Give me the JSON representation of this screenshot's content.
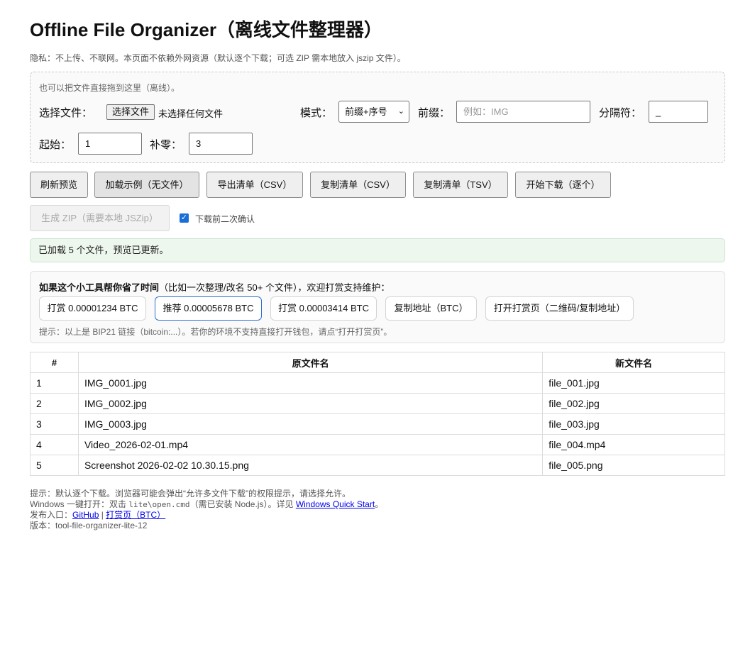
{
  "title": "Offline File Organizer（离线文件整理器）",
  "privacy": "隐私：不上传、不联网。本页面不依赖外网资源（默认逐个下载；可选 ZIP 需本地放入 jszip 文件）。",
  "dropzone": {
    "hint": "也可以把文件直接拖到这里（离线）。",
    "file_label": "选择文件：",
    "file_button": "选择文件",
    "file_status": "未选择任何文件",
    "mode_label": "模式：",
    "mode_value": "前缀+序号",
    "prefix_label": "前缀：",
    "prefix_placeholder": "例如：IMG",
    "sep_label": "分隔符：",
    "sep_value": "_",
    "start_label": "起始：",
    "start_value": "1",
    "pad_label": "补零：",
    "pad_value": "3"
  },
  "actions": {
    "refresh": "刷新预览",
    "load_sample": "加载示例（无文件）",
    "export_csv": "导出清单（CSV）",
    "copy_csv": "复制清单（CSV）",
    "copy_tsv": "复制清单（TSV）",
    "download": "开始下载（逐个）",
    "zip": "生成 ZIP（需要本地 JSZip）",
    "confirm_label": "下载前二次确认",
    "confirm_checked": true
  },
  "status": "已加载 5 个文件，预览已更新。",
  "donate": {
    "title_bold": "如果这个小工具帮你省了时间",
    "title_rest": "（比如一次整理/改名 50+ 个文件），欢迎打赏支持维护：",
    "buttons": [
      "打赏 0.00001234 BTC",
      "推荐 0.00005678 BTC",
      "打赏 0.00003414 BTC",
      "复制地址（BTC）",
      "打开打赏页（二维码/复制地址）"
    ],
    "tip": "提示：以上是 BIP21 链接（bitcoin:...）。若你的环境不支持直接打开钱包，请点“打开打赏页”。"
  },
  "table": {
    "headers": [
      "#",
      "原文件名",
      "新文件名"
    ],
    "rows": [
      [
        "1",
        "IMG_0001.jpg",
        "file_001.jpg"
      ],
      [
        "2",
        "IMG_0002.jpg",
        "file_002.jpg"
      ],
      [
        "3",
        "IMG_0003.jpg",
        "file_003.jpg"
      ],
      [
        "4",
        "Video_2026-02-01.mp4",
        "file_004.mp4"
      ],
      [
        "5",
        "Screenshot 2026-02-02 10.30.15.png",
        "file_005.png"
      ]
    ]
  },
  "footer": {
    "line1": "提示：默认逐个下载。浏览器可能会弹出“允许多文件下载”的权限提示，请选择允许。",
    "line2_pre": "Windows 一键打开：双击 ",
    "line2_code": "lite\\open.cmd",
    "line2_mid": "（需已安装 Node.js）。详见 ",
    "line2_link": "Windows Quick Start",
    "line2_end": "。",
    "line3_pre": "发布入口：",
    "line3_link1": "GitHub",
    "line3_sep": " | ",
    "line3_link2": "打赏页（BTC）",
    "line4": "版本：tool-file-organizer-lite-12"
  }
}
